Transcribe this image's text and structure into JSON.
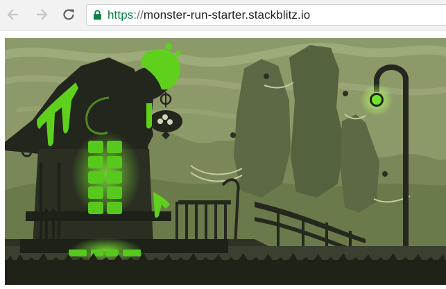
{
  "browser": {
    "back_icon": "arrow-left-icon",
    "forward_icon": "arrow-right-icon",
    "reload_icon": "reload-icon",
    "secure_icon": "lock-icon",
    "address": {
      "scheme": "https",
      "separator": "://",
      "host": "monster-run-starter.stackblitz.io"
    },
    "colors": {
      "secure": "#0b8043",
      "toolbar": "#f2f2f2"
    }
  },
  "game": {
    "colors": {
      "sky": "#8c9a69",
      "glow": "#59d41c",
      "silhouette": "#24281e"
    }
  }
}
